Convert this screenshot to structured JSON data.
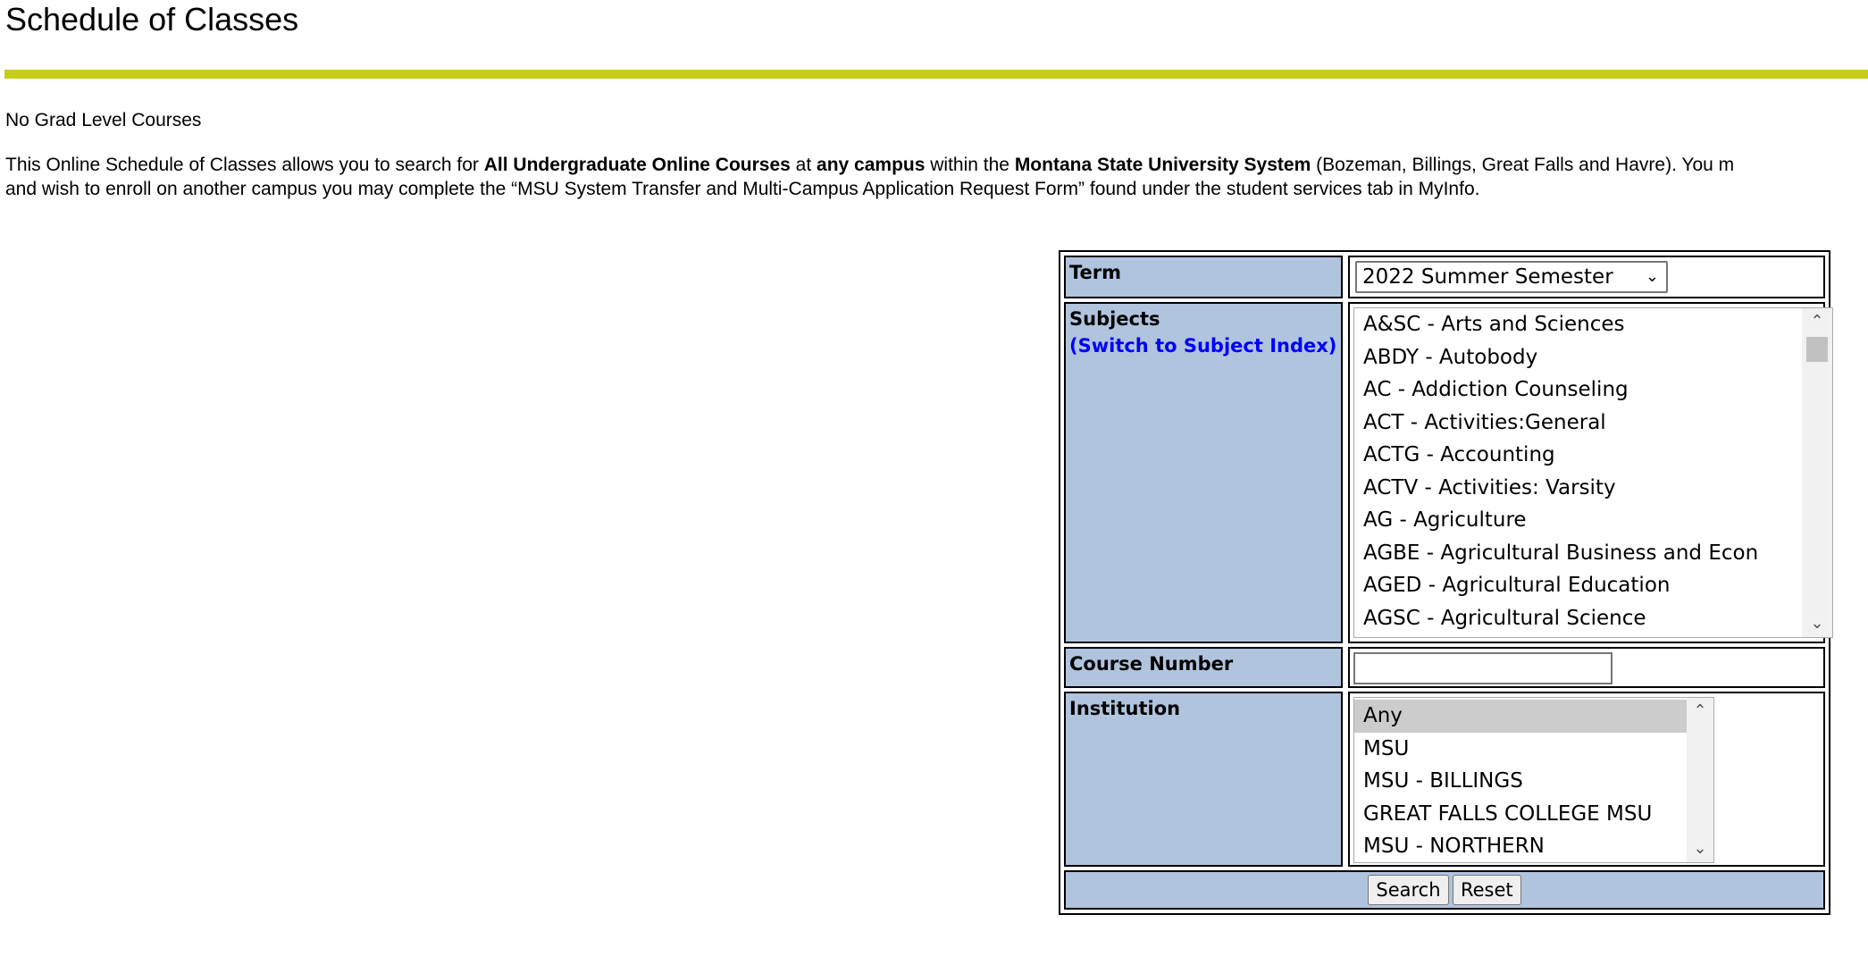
{
  "page": {
    "title": "Schedule of Classes",
    "accent_color": "#c8cc1a",
    "label_bg_color": "#b0c4de"
  },
  "note": "No Grad Level Courses",
  "intro": {
    "l1_a": "This Online Schedule of Classes allows you to search for ",
    "l1_b": "All Undergraduate Online Courses",
    "l1_c": " at ",
    "l1_d": "any campus",
    "l1_e": " within the ",
    "l1_f": "Montana State University System",
    "l1_g": " (Bozeman, Billings, Great Falls and Havre). You m",
    "l2": "and wish to enroll on another campus you may complete the “MSU System Transfer and Multi-Campus Application Request Form” found under the student services tab in MyInfo."
  },
  "form": {
    "term": {
      "label": "Term",
      "selected": "2022 Summer Semester"
    },
    "subjects": {
      "label": "Subjects",
      "link": "(Switch to Subject Index)",
      "options": [
        "A&SC - Arts and Sciences",
        "ABDY - Autobody",
        "AC - Addiction Counseling",
        "ACT - Activities:General",
        "ACTG - Accounting",
        "ACTV - Activities: Varsity",
        "AG - Agriculture",
        "AGBE - Agricultural Business and Econ",
        "AGED - Agricultural Education",
        "AGSC - Agricultural Science"
      ]
    },
    "course_number": {
      "label": "Course Number",
      "value": ""
    },
    "institution": {
      "label": "Institution",
      "selected": "Any",
      "options": [
        "Any",
        "MSU",
        "MSU - BILLINGS",
        "GREAT FALLS COLLEGE MSU",
        "MSU - NORTHERN"
      ]
    },
    "buttons": {
      "search": "Search",
      "reset": "Reset"
    }
  }
}
